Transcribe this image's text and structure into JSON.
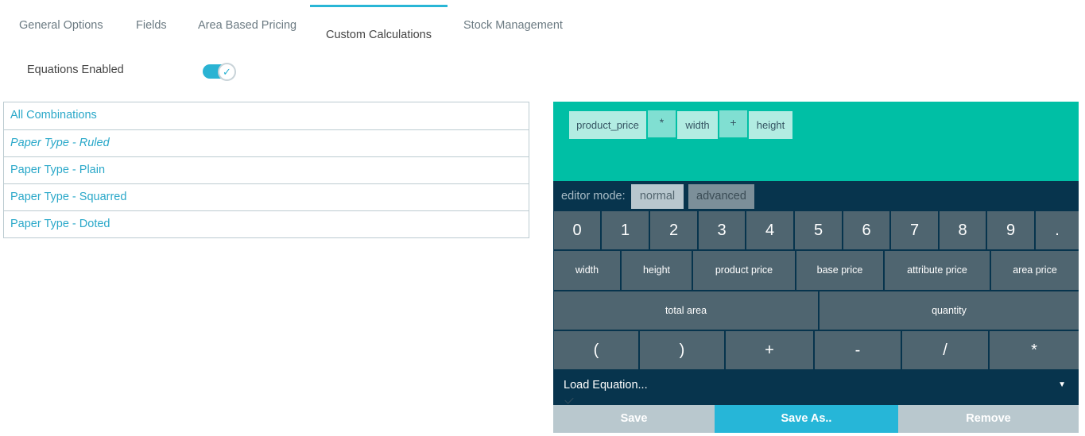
{
  "tabs": [
    {
      "label": "General Options",
      "active": false
    },
    {
      "label": "Fields",
      "active": false
    },
    {
      "label": "Area Based Pricing",
      "active": false
    },
    {
      "label": "Custom Calculations",
      "active": true
    },
    {
      "label": "Stock Management",
      "active": false
    }
  ],
  "equations": {
    "label": "Equations Enabled",
    "enabled": true,
    "check_icon": "✓"
  },
  "combinations": [
    {
      "label": "All Combinations",
      "selected": false
    },
    {
      "label": "Paper Type - Ruled",
      "selected": true
    },
    {
      "label": "Paper Type - Plain",
      "selected": false
    },
    {
      "label": "Paper Type - Squarred",
      "selected": false
    },
    {
      "label": "Paper Type - Doted",
      "selected": false
    }
  ],
  "formula": {
    "tokens": [
      "product_price",
      "*",
      "width",
      "+",
      "height"
    ]
  },
  "editor_mode": {
    "label": "editor mode:",
    "options": [
      "normal",
      "advanced"
    ],
    "selected": "normal"
  },
  "keypad": {
    "numbers": [
      "0",
      "1",
      "2",
      "3",
      "4",
      "5",
      "6",
      "7",
      "8",
      "9",
      "."
    ],
    "variables": [
      "width",
      "height",
      "product price",
      "base price",
      "attribute price",
      "area price"
    ],
    "wide": [
      "total area",
      "quantity"
    ],
    "operators": [
      "(",
      ")",
      "+",
      "-",
      "/",
      "*"
    ]
  },
  "load_equation": {
    "placeholder": "Load Equation...",
    "caret": "▼"
  },
  "actions": {
    "save": "Save",
    "save_as": "Save As..",
    "remove": "Remove"
  },
  "colors": {
    "accent": "#29b6d6",
    "formula_bg": "#00bfa5",
    "editor_bg": "#07344d",
    "key_bg": "#4f6570",
    "link": "#2aa8c9"
  }
}
